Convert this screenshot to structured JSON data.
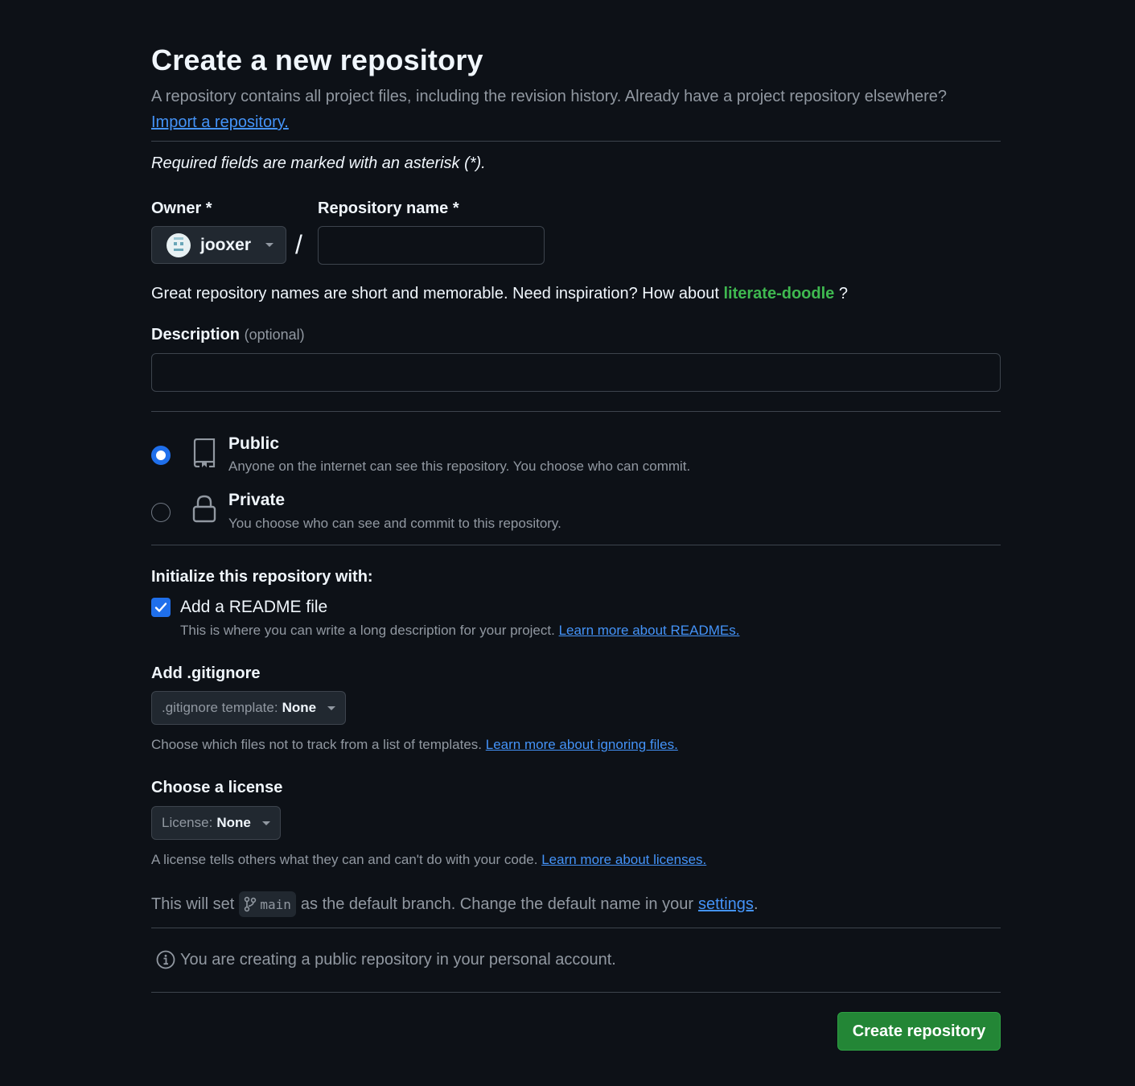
{
  "page": {
    "title": "Create a new repository",
    "subtitle": "A repository contains all project files, including the revision history. Already have a project repository elsewhere?",
    "import_link": "Import a repository.",
    "required_note": "Required fields are marked with an asterisk (*)."
  },
  "owner": {
    "label": "Owner *",
    "value": "jooxer"
  },
  "repo_name": {
    "label": "Repository name *",
    "value": "",
    "placeholder": ""
  },
  "separator": "/",
  "name_hint": {
    "text": "Great repository names are short and memorable. Need inspiration? How about",
    "suggestion": "literate-doodle",
    "suffix": "?"
  },
  "description": {
    "label": "Description",
    "optional": "(optional)",
    "value": ""
  },
  "visibility": {
    "selected": "public",
    "public": {
      "title": "Public",
      "desc": "Anyone on the internet can see this repository. You choose who can commit."
    },
    "private": {
      "title": "Private",
      "desc": "You choose who can see and commit to this repository."
    }
  },
  "init": {
    "heading": "Initialize this repository with:",
    "readme_checked": true,
    "readme_label": "Add a README file",
    "readme_desc": "This is where you can write a long description for your project.",
    "readme_link": "Learn more about READMEs."
  },
  "gitignore": {
    "heading": "Add .gitignore",
    "select_key": ".gitignore template:",
    "select_value": "None",
    "desc": "Choose which files not to track from a list of templates.",
    "link": "Learn more about ignoring files."
  },
  "license": {
    "heading": "Choose a license",
    "select_key": "License:",
    "select_value": "None",
    "desc": "A license tells others what they can and can't do with your code.",
    "link": "Learn more about licenses."
  },
  "branch": {
    "prefix": "This will set",
    "name": "main",
    "middle": "as the default branch. Change the default name in your",
    "settings_link": "settings",
    "suffix": "."
  },
  "notice": "You are creating a public repository in your personal account.",
  "submit_label": "Create repository",
  "colors": {
    "background": "#0d1117",
    "accent_green": "#238636",
    "link_blue": "#4493f8",
    "suggestion_green": "#3fb950",
    "radio_blue": "#1f6feb"
  }
}
